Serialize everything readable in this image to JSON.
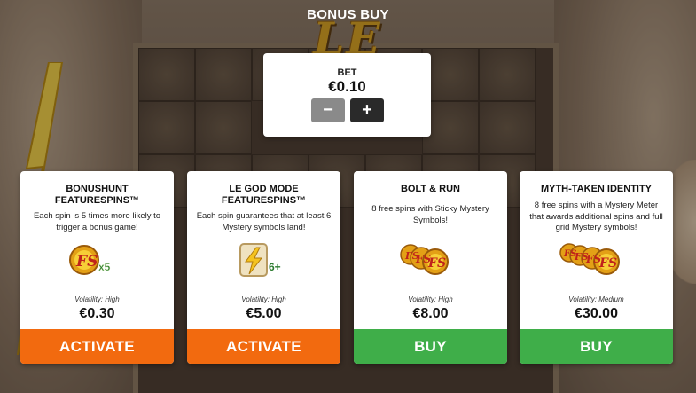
{
  "header": {
    "title": "BONUS BUY"
  },
  "background": {
    "logo_text": "LE ZEUS"
  },
  "bet": {
    "label": "BET",
    "value": "€0.10",
    "minus_label": "−",
    "plus_label": "+"
  },
  "cards": [
    {
      "title_line1": "BONUSHUNT",
      "title_line2": "FEATURESPINS™",
      "description": "Each spin is 5 times more likely to trigger a bonus game!",
      "art_badge": "x5",
      "volatility": "Volatility: High",
      "price": "€0.30",
      "action": "ACTIVATE",
      "action_color": "#f26a0f"
    },
    {
      "title_line1": "LE GOD MODE",
      "title_line2": "FEATURESPINS™",
      "description": "Each spin guarantees that at least 6 Mystery symbols land!",
      "art_badge": "6+",
      "volatility": "Volatility: High",
      "price": "€5.00",
      "action": "ACTIVATE",
      "action_color": "#f26a0f"
    },
    {
      "title_line1": "BOLT & RUN",
      "title_line2": "",
      "description": "8 free spins with Sticky Mystery Symbols!",
      "art_badge": "",
      "volatility": "Volatility: High",
      "price": "€8.00",
      "action": "BUY",
      "action_color": "#3fae49"
    },
    {
      "title_line1": "MYTH-TAKEN IDENTITY",
      "title_line2": "",
      "description": "8 free spins with a Mystery Meter that awards additional spins and full grid Mystery symbols!",
      "art_badge": "",
      "volatility": "Volatility: Medium",
      "price": "€30.00",
      "action": "BUY",
      "action_color": "#3fae49"
    }
  ],
  "icons": {
    "fs_coin": "fs-coin-icon",
    "lightning_scroll": "lightning-scroll-icon",
    "minus": "minus-icon",
    "plus": "plus-icon"
  },
  "colors": {
    "activate": "#f26a0f",
    "buy": "#3fae49",
    "bet_plus": "#2a2a2a",
    "bet_minus": "#8a8a8a"
  }
}
